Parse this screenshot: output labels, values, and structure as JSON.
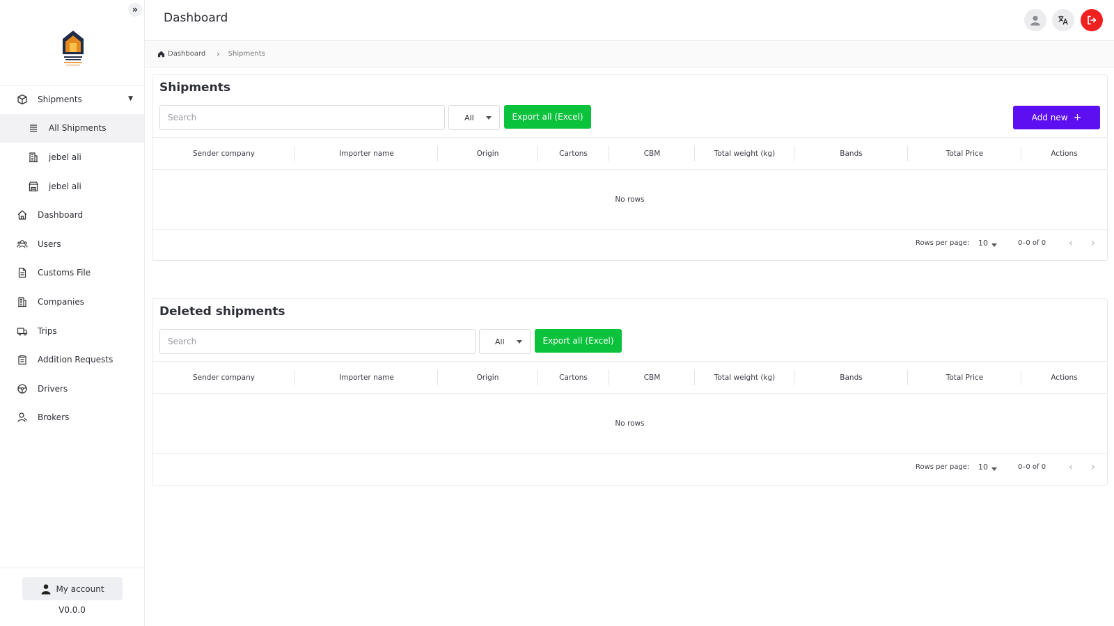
{
  "sidebar": {
    "collapse_icon": "double-chevron-right-icon",
    "logo_alt": "company-logo",
    "items": [
      {
        "label": "Shipments",
        "icon": "box-icon"
      },
      {
        "label": "All Shipments",
        "icon": "list-icon"
      },
      {
        "label": "jebel ali",
        "icon": "building-icon"
      },
      {
        "label": "jebel ali",
        "icon": "store-icon"
      },
      {
        "label": "Dashboard",
        "icon": "home-icon"
      },
      {
        "label": "Users",
        "icon": "users-icon"
      },
      {
        "label": "Customs File",
        "icon": "file-icon"
      },
      {
        "label": "Companies",
        "icon": "building-icon"
      },
      {
        "label": "Trips",
        "icon": "truck-icon"
      },
      {
        "label": "Addition Requests",
        "icon": "clipboard-icon"
      },
      {
        "label": "Drivers",
        "icon": "steering-wheel-icon"
      },
      {
        "label": "Brokers",
        "icon": "person-icon"
      }
    ],
    "account_label": "My account",
    "version": "V0.0.0"
  },
  "header": {
    "title": "Dashboard"
  },
  "breadcrumb": {
    "home": "Dashboard",
    "current": "Shipments"
  },
  "shipments": {
    "title": "Shipments",
    "search_placeholder": "Search",
    "filter_value": "All",
    "export_label": "Export all (Excel)",
    "add_label": "Add new",
    "add_icon": "+",
    "columns": [
      "Sender company",
      "Importer name",
      "Origin",
      "Cartons",
      "CBM",
      "Total weight (kg)",
      "Bands",
      "Total Price",
      "Actions"
    ],
    "empty_text": "No rows",
    "rows_per_page_label": "Rows per page:",
    "rows_per_page": "10",
    "range": "0–0 of 0"
  },
  "deleted": {
    "title": "Deleted shipments",
    "search_placeholder": "Search",
    "filter_value": "All",
    "export_label": "Export all (Excel)",
    "columns": [
      "Sender company",
      "Importer name",
      "Origin",
      "Cartons",
      "CBM",
      "Total weight (kg)",
      "Bands",
      "Total Price",
      "Actions"
    ],
    "empty_text": "No rows",
    "rows_per_page_label": "Rows per page:",
    "rows_per_page": "10",
    "range": "0–0 of 0"
  },
  "colors": {
    "export_green": "#0bc23c",
    "add_purple": "#5e0ff2",
    "logout_red": "#ef2020"
  }
}
